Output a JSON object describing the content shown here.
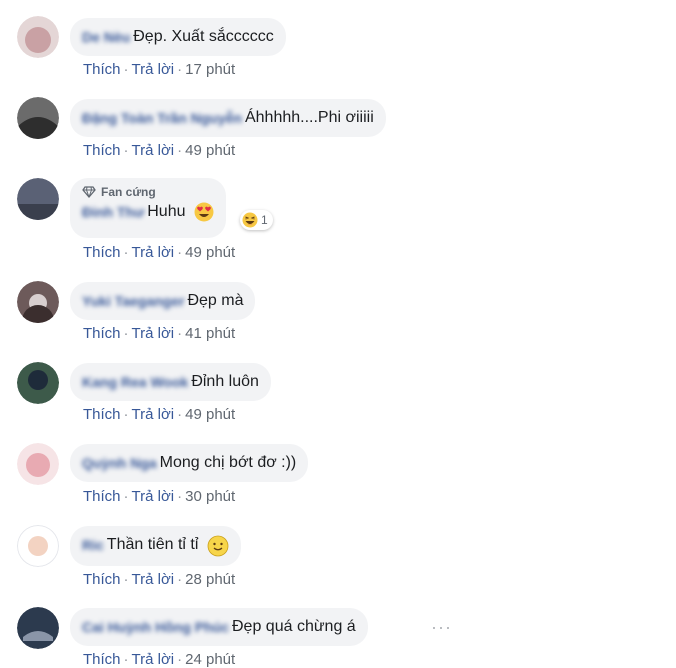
{
  "labels": {
    "like": "Thích",
    "reply": "Trả lời",
    "separator": "·"
  },
  "comments": [
    {
      "author": "De Nèu",
      "text": "Đẹp. Xuất sắcccccc",
      "time": "17 phút",
      "avatar_color": "#c9a6a6"
    },
    {
      "author": "Đặng Toàn Trần Nguyễn",
      "text": "Áhhhhh....Phi ơiiiii",
      "time": "49 phút",
      "avatar_color": "#3a3a3a"
    },
    {
      "author": "Đinh Thư",
      "badge": "Fan cứng",
      "text": "Huhu",
      "time": "49 phút",
      "avatar_color": "#4a5063",
      "reaction_count": "1"
    },
    {
      "author": "Yuki Taeganger",
      "text": "Đẹp mà",
      "time": "41 phút",
      "avatar_color": "#4a3b3b"
    },
    {
      "author": "Kang Rea Wook",
      "text": "Đỉnh luôn",
      "time": "49 phút",
      "avatar_color": "#2f3b3a"
    },
    {
      "author": "Quỳnh Nga",
      "text": "Mong chị bớt đơ :))",
      "time": "30 phút",
      "avatar_color": "#e8b7bd"
    },
    {
      "author": "Ric",
      "text": "Thần tiên tỉ tỉ",
      "time": "28 phút",
      "avatar_color": "#f0d4c4"
    },
    {
      "author": "Cai Huỳnh Hồng Phúc",
      "text": "Đẹp quá chừng á",
      "time": "24 phút",
      "avatar_color": "#2c3a4e"
    }
  ],
  "more_label": "···"
}
